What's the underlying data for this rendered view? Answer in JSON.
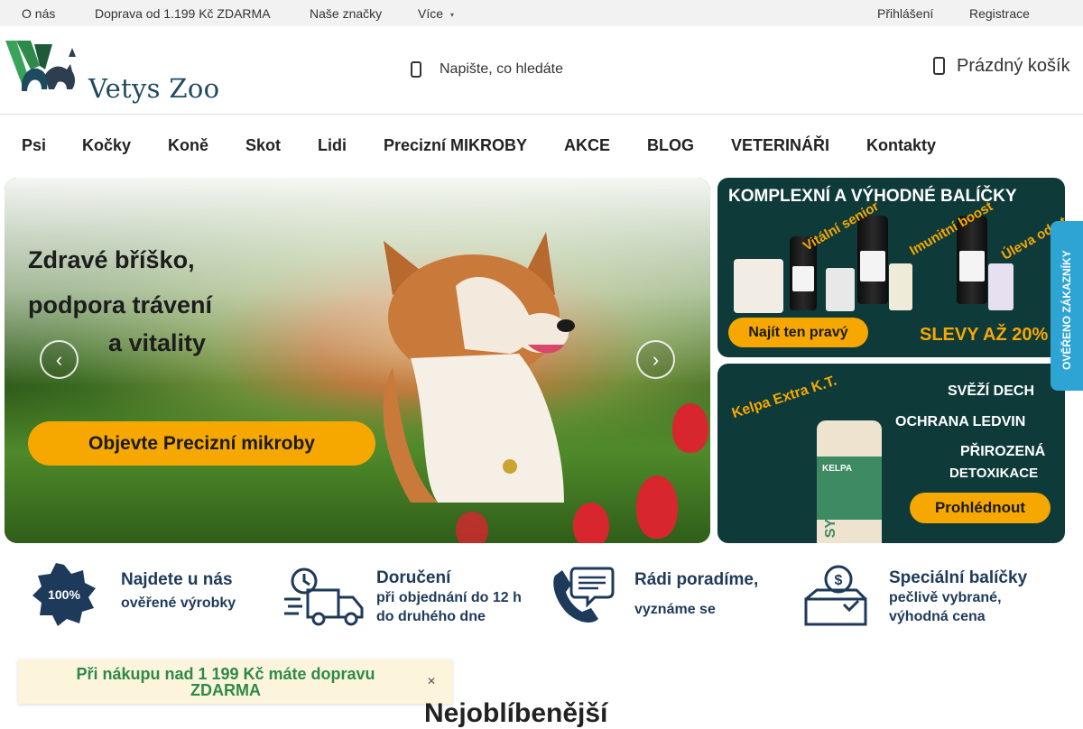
{
  "topbar": {
    "links": [
      "O nás",
      "Doprava od 1.199 Kč ZDARMA",
      "Naše značky",
      "Více"
    ],
    "more_caret": "▾",
    "login": "Přihlášení",
    "register": "Registrace"
  },
  "header": {
    "logo_text": "Vetys Zoo",
    "search_placeholder": "Napište, co hledáte",
    "cart_label": "Prázdný košík"
  },
  "nav": {
    "items": [
      "Psi",
      "Kočky",
      "Koně",
      "Skot",
      "Lidi",
      "Precizní MIKROBY",
      "AKCE",
      "BLOG",
      "VETERINÁŘI",
      "Kontakty"
    ]
  },
  "hero": {
    "line1": "Zdravé bříško,",
    "line2": "podpora trávení",
    "line3": "a vitality",
    "cta": "Objevte Precizní mikroby",
    "prev_glyph": "‹",
    "next_glyph": "›"
  },
  "banner_top": {
    "title": "KOMPLEXNÍ A VÝHODNÉ BALÍČKY",
    "tags": [
      "Vitální senior",
      "Imunitní boost",
      "Úleva od stresu"
    ],
    "cta": "Najít ten pravý",
    "discount": "SLEVY AŽ 20%"
  },
  "banner_bottom": {
    "product": "Kelpa Extra K.T.",
    "benefits": [
      "SVĚŽÍ DECH",
      "OCHRANA LEDVIN",
      "PŘIROZENÁ",
      "DETOXIKACE"
    ],
    "cta": "Prohlédnout",
    "pack_brand": "SYPET",
    "pack_name": "KELPA"
  },
  "side_tab": {
    "label": "OVĚŘENO ZÁKAZNÍKY"
  },
  "features": [
    {
      "main": "Najdete u nás",
      "sub": "ověřené výrobky",
      "icon": "quality-badge-icon",
      "badge": "100%"
    },
    {
      "main": "Doručení",
      "sub": "při objednání do 12 h",
      "sub2": "do druhého dne",
      "icon": "delivery-truck-icon"
    },
    {
      "main": "Rádi poradíme,",
      "sub": "vyznáme se",
      "icon": "phone-chat-icon"
    },
    {
      "main": "Speciální balíčky",
      "sub": "pečlivě vybrané,",
      "sub2": "výhodná cena",
      "icon": "package-offer-icon"
    }
  ],
  "notice": {
    "text": "Při nákupu nad 1 199 Kč máte dopravu ZDARMA",
    "close": "✕"
  },
  "section": {
    "title": "Nejoblíbenější"
  },
  "colors": {
    "accent": "#f6a800",
    "brand_green": "#2d8a4a",
    "brand_navy": "#1e3a5a",
    "banner_bg": "#0f3a3a",
    "side_tab": "#2ea4d4"
  }
}
